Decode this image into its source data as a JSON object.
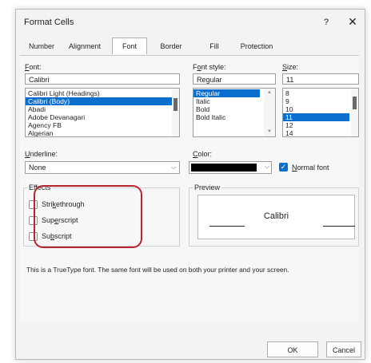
{
  "window": {
    "title": "Format Cells",
    "help": "?",
    "close": "✕"
  },
  "tabs": [
    "Number",
    "Alignment",
    "Font",
    "Border",
    "Fill",
    "Protection"
  ],
  "font": {
    "label": "Font:",
    "label_key": "F",
    "label_rest": "ont:",
    "value": "Calibri",
    "list": [
      "Calibri Light (Headings)",
      "Calibri (Body)",
      "Abadi",
      "Adobe Devanagari",
      "Agency FB",
      "Algerian"
    ],
    "selected_index": 1
  },
  "font_style": {
    "label_a": "F",
    "label_key": "o",
    "label_rest": "nt style:",
    "value": "Regular",
    "list": [
      "Regular",
      "Italic",
      "Bold",
      "Bold Italic"
    ],
    "selected_index": 0
  },
  "size": {
    "label_key": "S",
    "label_rest": "ize:",
    "value": "11",
    "list": [
      "8",
      "9",
      "10",
      "11",
      "12",
      "14"
    ],
    "selected_index": 3
  },
  "underline": {
    "label_key": "U",
    "label_rest": "nderline:",
    "value": "None"
  },
  "color": {
    "label_key": "C",
    "label_rest": "olor:",
    "swatch": "#000000",
    "normal_font_key": "N",
    "normal_font_rest": "ormal font"
  },
  "effects": {
    "title": "Effects",
    "strike_a": "Stri",
    "strike_key": "k",
    "strike_b": "ethrough",
    "super_a": "Sup",
    "super_key": "e",
    "super_b": "rscript",
    "sub_a": "Su",
    "sub_key": "b",
    "sub_b": "script"
  },
  "preview": {
    "title": "Preview",
    "text": "Calibri"
  },
  "info": "This is a TrueType font.  The same font will be used on both your printer and your screen.",
  "buttons": {
    "ok": "OK",
    "cancel": "Cancel"
  },
  "colors": {
    "accent": "#0b6fce",
    "highlight": "#b6252d"
  }
}
